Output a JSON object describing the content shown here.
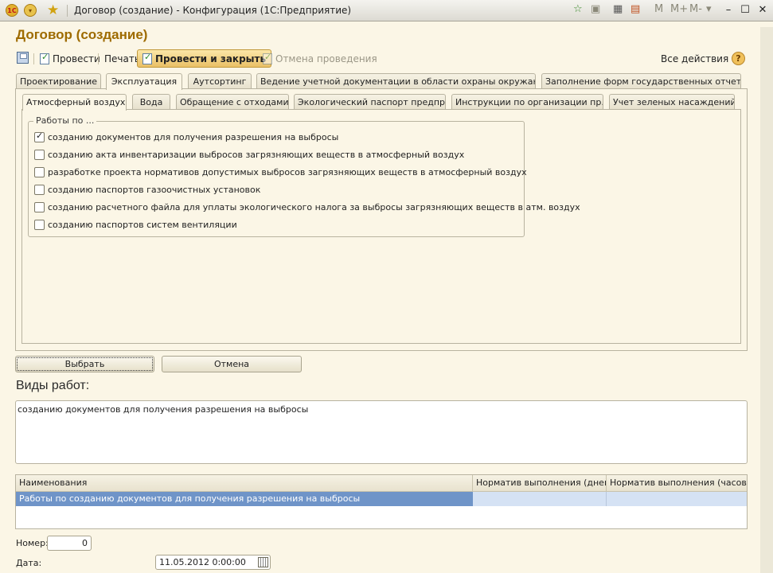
{
  "window": {
    "title": "Договор (создание) - Конфигурация  (1С:Предприятие)",
    "logo": "1С"
  },
  "form": {
    "title": "Договор (создание)"
  },
  "toolbar": {
    "post_label": "Провести",
    "print_label": "Печать",
    "post_close_label": "Провести и закрыть",
    "cancel_post_label": "Отмена проведения",
    "all_actions_label": "Все действия ▾",
    "help_label": "?"
  },
  "titlebar_right": {
    "m": "M",
    "mplus": "M+",
    "mminus": "M-"
  },
  "outer_tabs": [
    {
      "label": "Проектирование"
    },
    {
      "label": "Эксплуатация"
    },
    {
      "label": "Аутсортинг"
    },
    {
      "label": "Ведение учетной документации в области охраны окружающей..."
    },
    {
      "label": "Заполнение форм государственных отчетов"
    }
  ],
  "inner_tabs": [
    {
      "label": "Атмосферный воздух"
    },
    {
      "label": "Вода"
    },
    {
      "label": "Обращение с отходами"
    },
    {
      "label": "Экологический паспорт предпр..."
    },
    {
      "label": "Инструкции по организации пр..."
    },
    {
      "label": "Учет зеленых насаждений"
    }
  ],
  "group": {
    "title": "Работы по ...",
    "items": [
      {
        "label": "созданию документов для получения разрешения на выбросы",
        "checked": true
      },
      {
        "label": "созданию акта инвентаризации выбросов загрязняющих веществ в атмосферный воздух",
        "checked": false
      },
      {
        "label": "разработке проекта нормативов допустимых выбросов загрязняющих веществ в атмосферный воздух",
        "checked": false
      },
      {
        "label": "созданию паспортов газоочистных установок",
        "checked": false
      },
      {
        "label": "созданию расчетного файла для уплаты экологического налога за выбросы загрязняющих веществ в атм. воздух",
        "checked": false
      },
      {
        "label": "созданию паспортов систем вентиляции",
        "checked": false
      }
    ]
  },
  "buttons": {
    "select_label": "Выбрать",
    "cancel_label": "Отмена"
  },
  "work_types": {
    "label": "Виды работ:",
    "value": "созданию документов для получения разрешения на выбросы"
  },
  "table": {
    "columns": [
      "Наименования",
      "Норматив выполнения (дней)",
      "Норматив выполнения (часов)"
    ],
    "rows": [
      [
        "Работы по созданию документов для получения разрешения на выбросы",
        "",
        ""
      ]
    ]
  },
  "fields": {
    "number_label": "Номер:",
    "number_value": "0",
    "date_label": "Дата:",
    "date_value": "11.05.2012  0:00:00"
  }
}
